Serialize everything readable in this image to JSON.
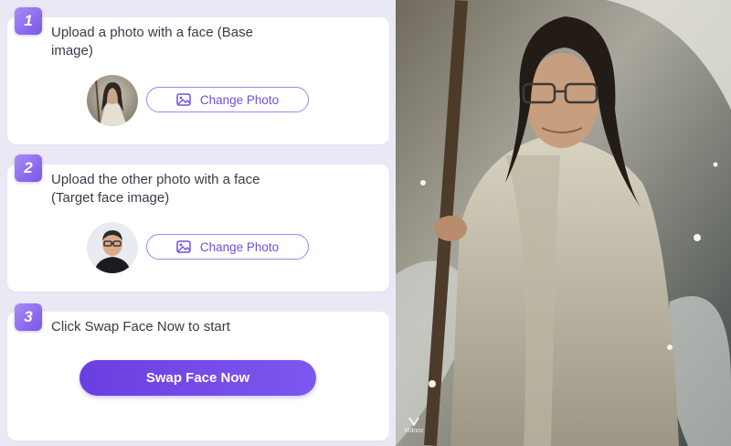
{
  "steps": [
    {
      "number": "1",
      "text_line1": "Upload a photo with a face (Base",
      "text_line2": "image)",
      "button_label": "Change Photo"
    },
    {
      "number": "2",
      "text_line1": "Upload the other photo with a face",
      "text_line2": "(Target face image)",
      "button_label": "Change Photo"
    },
    {
      "number": "3",
      "text_line1": "Click Swap Face Now to start",
      "button_label": "Swap Face Now"
    }
  ],
  "watermark": "Vidnoz",
  "colors": {
    "accent": "#7a55e8",
    "button_gradient_start": "#6a3fe0",
    "button_gradient_end": "#7d57ef",
    "panel_bg": "#ebe8f6"
  }
}
